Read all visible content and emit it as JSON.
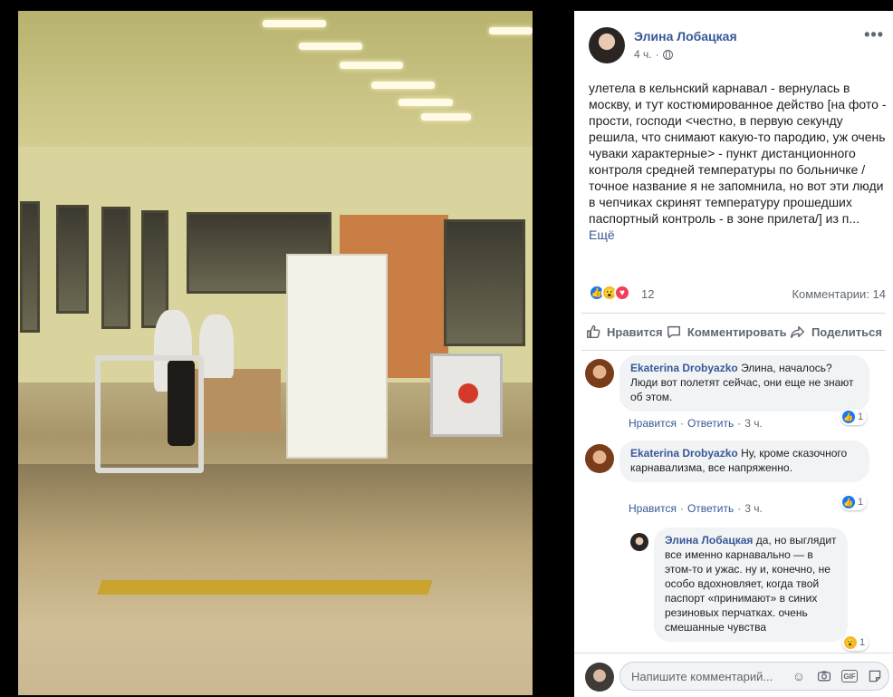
{
  "post": {
    "author": "Элина Лобацкая",
    "time": "4 ч.",
    "text": "улетела в кельнский карнавал - вернулась в москву, и тут костюмированное действо [на фото - прости, господи <честно, в первую секунду решила, что снимают какую-то пародию, уж очень чуваки характерные> - пункт дистанционного контроля средней температуры по больничке /точное название я не запомнила, но вот эти люди в чепчиках скринят температуру прошедших паспортный контроль - в зоне прилета/] из п...",
    "see_more": "Ещё",
    "reaction_count": "12",
    "comments_count": "Комментарии: 14"
  },
  "actions": {
    "like": "Нравится",
    "comment": "Комментировать",
    "share": "Поделиться"
  },
  "comments": [
    {
      "name": "Ekaterina Drobyazko",
      "text": "Элина, началось? Люди вот полетят сейчас, они еще не знают об этом.",
      "like": "Нравится",
      "reply": "Ответить",
      "time": "3 ч.",
      "reactions": "1"
    },
    {
      "name": "Ekaterina Drobyazko",
      "text": "Ну, кроме сказочного карнавализма, все напряженно.",
      "like": "Нравится",
      "reply": "Ответить",
      "time": "3 ч.",
      "reactions": "1"
    },
    {
      "name": "Элина Лобацкая",
      "text": "да, но выглядит все именно карнавально — в этом-то и ужас. ну и, конечно, не особо вдохновляет, когда твой паспорт «принимают» в синих резиновых перчатках. очень смешанные чувства",
      "reactions": "1"
    }
  ],
  "composer": {
    "placeholder": "Напишите комментарий..."
  },
  "icons": [
    "more-icon",
    "globe-icon",
    "like-icon",
    "comment-icon",
    "share-icon",
    "emoji-icon",
    "camera-icon",
    "gif-icon",
    "sticker-icon"
  ],
  "colors": {
    "link": "#385898",
    "like_blue": "#1877f2",
    "love_red": "#f33e58",
    "wow_yellow": "#f7b928",
    "bubble": "#f2f3f5"
  }
}
